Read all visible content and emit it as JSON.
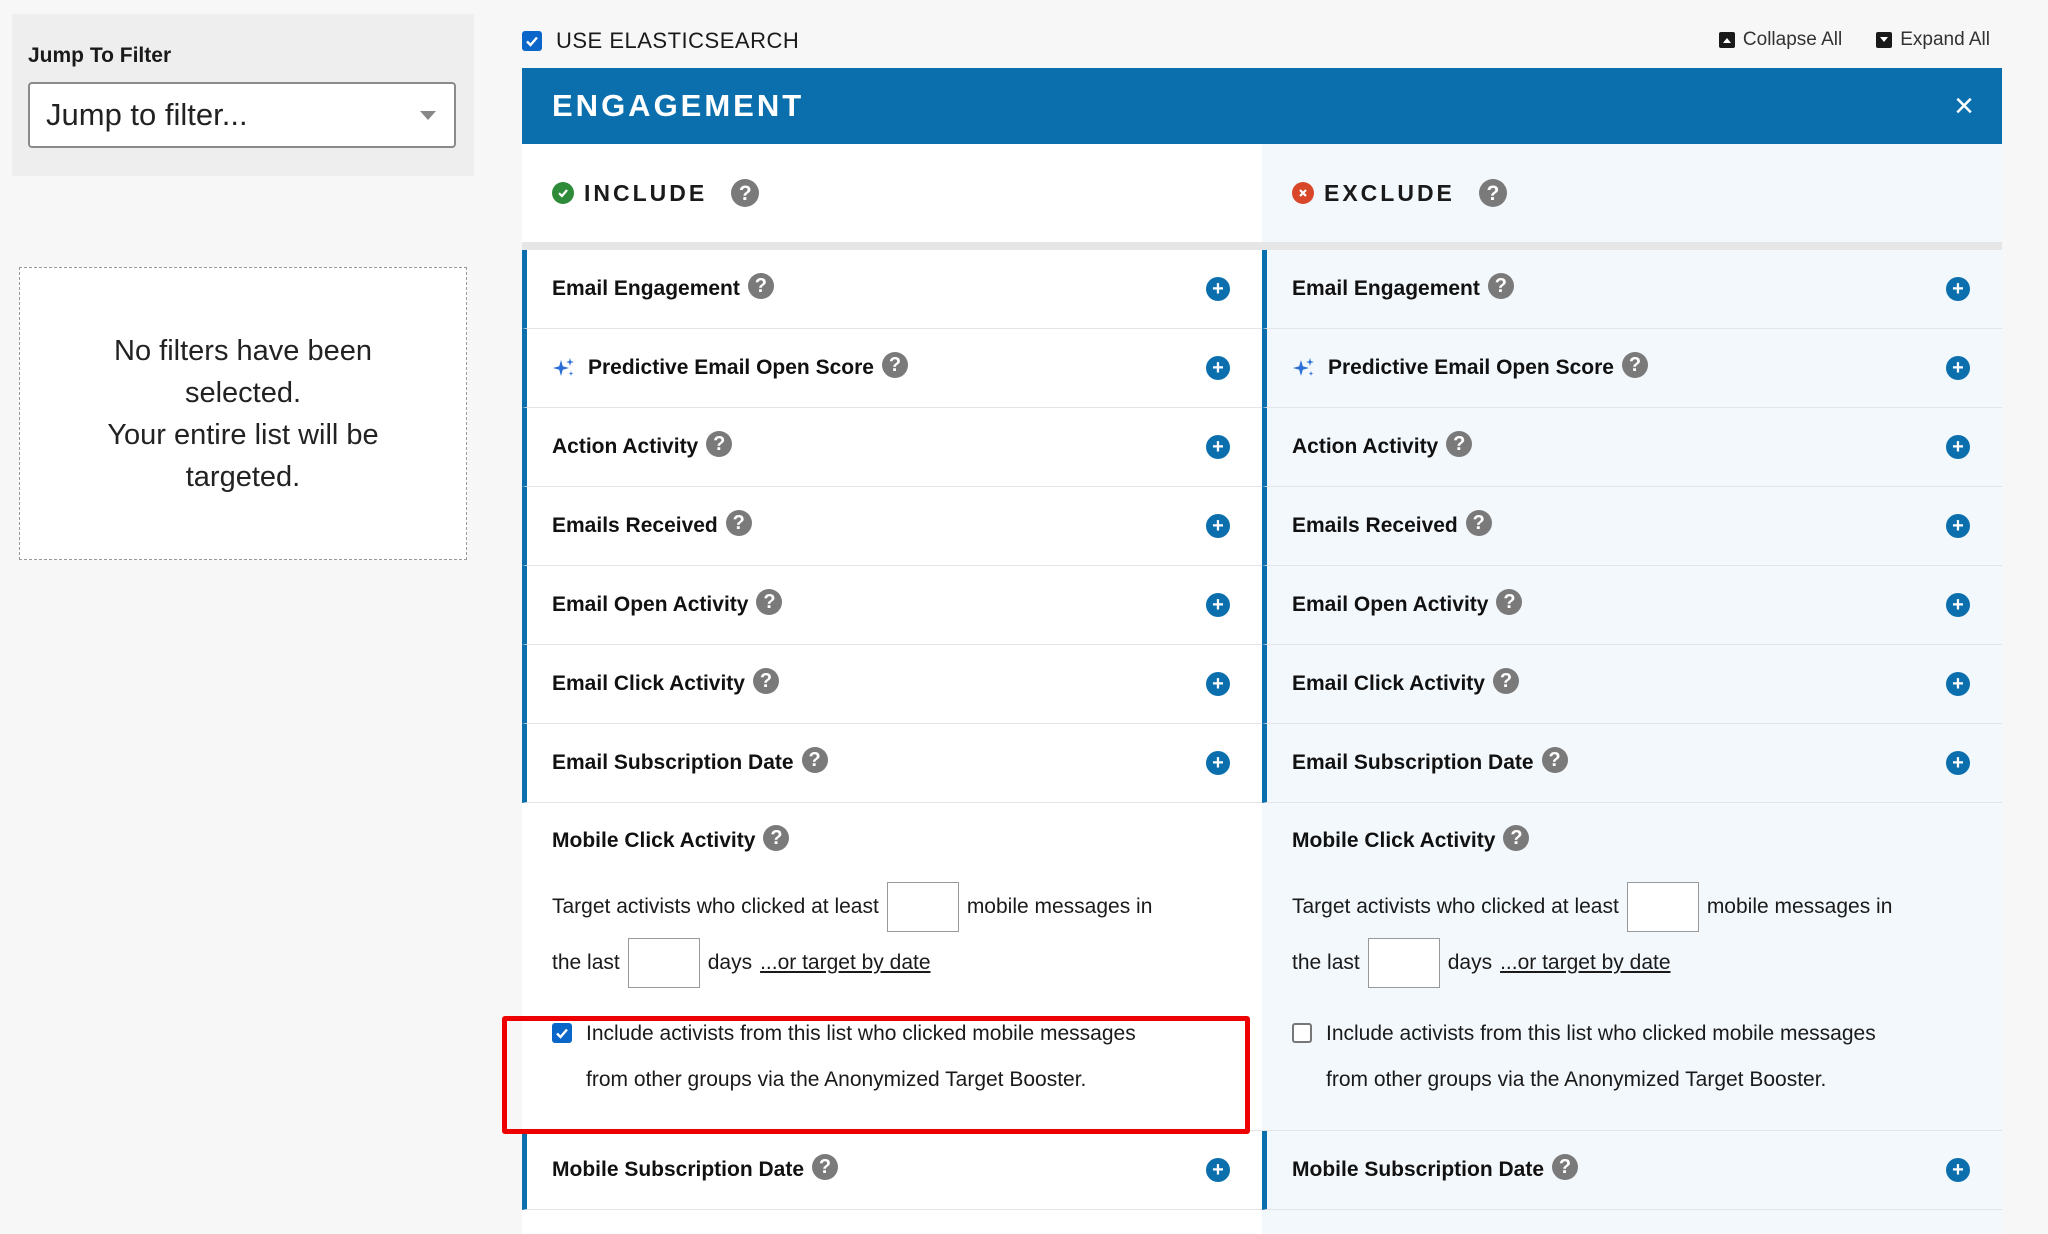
{
  "jump": {
    "title": "Jump To Filter",
    "placeholder": "Jump to filter..."
  },
  "empty_state": {
    "line1": "No filters have been selected.",
    "line2": "Your entire list will be targeted."
  },
  "top": {
    "use_es_label": "USE ELASTICSEARCH",
    "use_es_checked": true,
    "collapse_label": "Collapse All",
    "expand_label": "Expand All"
  },
  "panel": {
    "title": "ENGAGEMENT",
    "close": "×",
    "accent": "#0b6fae"
  },
  "columns": {
    "include": {
      "label": "INCLUDE",
      "color": "#2e8b3a"
    },
    "exclude": {
      "label": "EXCLUDE",
      "color": "#d9472b"
    }
  },
  "filters": [
    {
      "label": "Email Engagement"
    },
    {
      "label": "Predictive Email Open Score",
      "icon": "sparkle-icon"
    },
    {
      "label": "Action Activity"
    },
    {
      "label": "Emails Received"
    },
    {
      "label": "Email Open Activity"
    },
    {
      "label": "Email Click Activity"
    },
    {
      "label": "Email Subscription Date"
    }
  ],
  "mobile_click": {
    "title": "Mobile Click Activity",
    "text_before": "Target activists who clicked at least",
    "text_after": "mobile messages in",
    "the_last": "the last",
    "days": "days",
    "date_link": "...or target by date",
    "booster_line1": "Include activists from this list who clicked mobile messages",
    "booster_line2": "from other groups via the Anonymized Target Booster.",
    "include_booster_checked": true,
    "exclude_booster_checked": false
  },
  "after_filters": [
    {
      "label": "Mobile Subscription Date"
    }
  ],
  "help_glyph": "?",
  "plus_glyph": "+"
}
